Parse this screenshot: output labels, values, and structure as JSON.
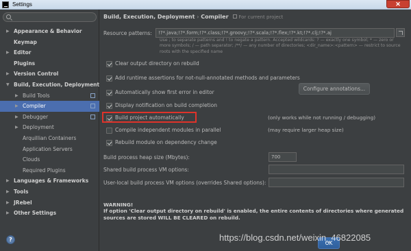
{
  "window": {
    "title": "Settings",
    "close_glyph": "✕"
  },
  "sidebar": {
    "search_placeholder": "",
    "items": [
      {
        "label": "Appearance & Behavior",
        "arrow": "▶",
        "level": 0,
        "bold": true
      },
      {
        "label": "Keymap",
        "arrow": "",
        "level": 0,
        "bold": true
      },
      {
        "label": "Editor",
        "arrow": "▶",
        "level": 0,
        "bold": true
      },
      {
        "label": "Plugins",
        "arrow": "",
        "level": 0,
        "bold": true
      },
      {
        "label": "Version Control",
        "arrow": "▶",
        "level": 0,
        "bold": true
      },
      {
        "label": "Build, Execution, Deployment",
        "arrow": "▼",
        "level": 0,
        "bold": true
      },
      {
        "label": "Build Tools",
        "arrow": "▶",
        "level": 1,
        "bold": false
      },
      {
        "label": "Compiler",
        "arrow": "▶",
        "level": 1,
        "bold": false,
        "selected": true
      },
      {
        "label": "Debugger",
        "arrow": "▶",
        "level": 1,
        "bold": false
      },
      {
        "label": "Deployment",
        "arrow": "▶",
        "level": 1,
        "bold": false
      },
      {
        "label": "Arquillian Containers",
        "arrow": "",
        "level": 1,
        "bold": false
      },
      {
        "label": "Application Servers",
        "arrow": "",
        "level": 1,
        "bold": false
      },
      {
        "label": "Clouds",
        "arrow": "",
        "level": 1,
        "bold": false
      },
      {
        "label": "Required Plugins",
        "arrow": "",
        "level": 1,
        "bold": false
      },
      {
        "label": "Languages & Frameworks",
        "arrow": "▶",
        "level": 0,
        "bold": true
      },
      {
        "label": "Tools",
        "arrow": "▶",
        "level": 0,
        "bold": true
      },
      {
        "label": "JRebel",
        "arrow": "▶",
        "level": 0,
        "bold": true
      },
      {
        "label": "Other Settings",
        "arrow": "▶",
        "level": 0,
        "bold": true
      }
    ],
    "help_label": "?"
  },
  "header": {
    "path_parent": "Build, Execution, Deployment",
    "separator": "›",
    "path_current": "Compiler",
    "note": "For current project"
  },
  "resource_patterns": {
    "label": "Resource patterns:",
    "value": "!?*.java;!?*.form;!?*.class;!?*.groovy;!?*.scala;!?*.flex;!?*.kt;!?*.clj;!?*.aj",
    "hint": "Use ; to separate patterns and ! to negate a pattern. Accepted wildcards: ? — exactly one symbol; * — zero or more symbols; / — path separator; /**/ — any number of directories; <dir_name>:<pattern> — restrict to source roots with the specified name"
  },
  "options": [
    {
      "label": "Clear output directory on rebuild",
      "checked": true,
      "note": ""
    },
    {
      "label": "Add runtime assertions for not-null-annotated methods and parameters",
      "checked": true,
      "note": ""
    },
    {
      "label": "Automatically show first error in editor",
      "checked": true,
      "note": ""
    },
    {
      "label": "Display notification on build completion",
      "checked": true,
      "note": ""
    },
    {
      "label": "Build project automatically",
      "checked": true,
      "note": "(only works while not running / debugging)"
    },
    {
      "label": "Compile independent modules in parallel",
      "checked": false,
      "note": "(may require larger heap size)"
    },
    {
      "label": "Rebuild module on dependency change",
      "checked": true,
      "note": ""
    }
  ],
  "configure_annotations_label": "Configure annotations...",
  "heap": {
    "label": "Build process heap size (Mbytes):",
    "value": "700"
  },
  "shared_vm": {
    "label": "Shared build process VM options:",
    "value": ""
  },
  "user_vm": {
    "label": "User-local build process VM options (overrides Shared options):",
    "value": ""
  },
  "warning": {
    "title": "WARNING!",
    "text": "If option 'Clear output directory on rebuild' is enabled, the entire contents of directories where generated sources are stored WILL BE CLEARED on rebuild."
  },
  "footer": {
    "ok_label": "OK"
  },
  "watermark": "https://blog.csdn.net/weixin_46822085",
  "colors": {
    "background": "#3c3f41",
    "selection": "#4b6eaf",
    "highlight_box": "#e0332a"
  }
}
